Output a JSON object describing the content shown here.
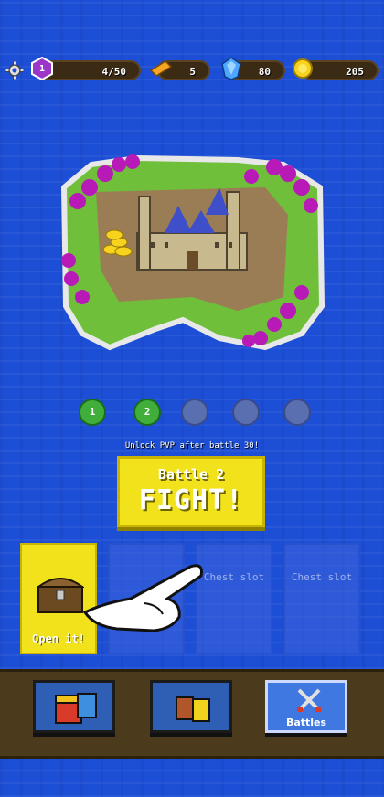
{
  "top_bar": {
    "level": "1",
    "xp": "4/50",
    "tickets": "5",
    "gems": "80",
    "coins": "205"
  },
  "levels": [
    {
      "label": "1"
    },
    {
      "label": "2"
    }
  ],
  "unlock_text": "Unlock PVP after battle 30!",
  "fight_button": {
    "subtitle": "Battle 2",
    "label": "FIGHT!"
  },
  "chest_slots": [
    {
      "label": "Open it!"
    },
    {
      "label": ""
    },
    {
      "label": "Chest slot"
    },
    {
      "label": "Chest slot"
    }
  ],
  "bottom_nav": {
    "battles_label": "Battles"
  },
  "colors": {
    "ocean": "#1d4fd6",
    "accent_yellow": "#f1e21c",
    "bar_brown": "#4b3a1b"
  },
  "icons": [
    "gear-icon",
    "level-hex-icon",
    "ticket-icon",
    "gem-icon",
    "coin-icon",
    "chest-icon",
    "shop-chest-icon",
    "cards-icon",
    "crossed-swords-icon",
    "hand-pointer-icon"
  ]
}
